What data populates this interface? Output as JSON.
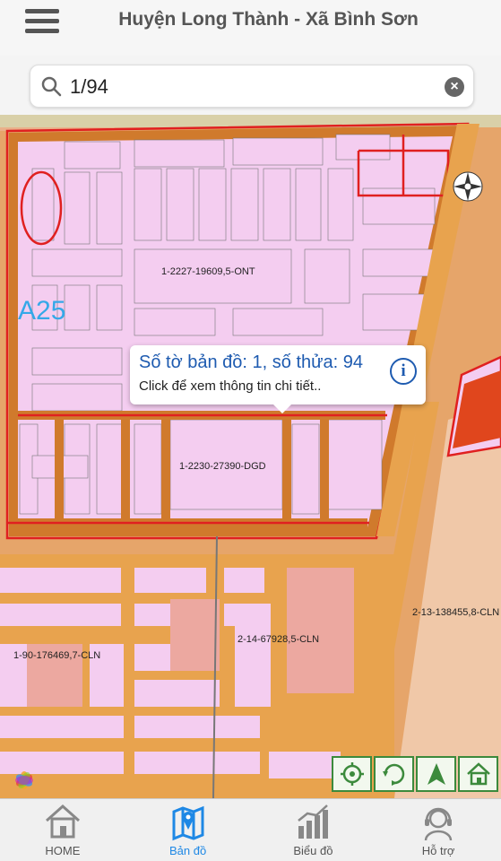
{
  "header": {
    "title": "Huyện Long Thành - Xã Bình Sơn"
  },
  "search": {
    "value": "1/94",
    "placeholder": ""
  },
  "map": {
    "parcel_labels": [
      "1-2227-19609,5-ONT",
      "1-2230-27390-DGD",
      "2-13-138455,8-CLN",
      "2-14-67928,5-CLN",
      "1-90-176469,7-CLN"
    ],
    "block_label": "A25",
    "popup": {
      "title": "Số tờ bản đồ: 1, số thửa: 94",
      "subtitle": "Click để xem thông tin chi tiết.."
    }
  },
  "map_tools": [
    "locate-icon",
    "rotate-icon",
    "north-arrow-icon",
    "home-icon"
  ],
  "bottom_nav": {
    "items": [
      {
        "label": "HOME",
        "icon": "home-icon"
      },
      {
        "label": "Bản đồ",
        "icon": "map-icon"
      },
      {
        "label": "Biểu đồ",
        "icon": "chart-icon"
      },
      {
        "label": "Hỗ trợ",
        "icon": "support-icon"
      }
    ],
    "active_index": 1
  },
  "colors": {
    "parcel": "#f4cdf0",
    "road": "#e8a34e",
    "boundary": "#e02020",
    "highlight": "#cc7a2a",
    "accent": "#1e88e5"
  }
}
